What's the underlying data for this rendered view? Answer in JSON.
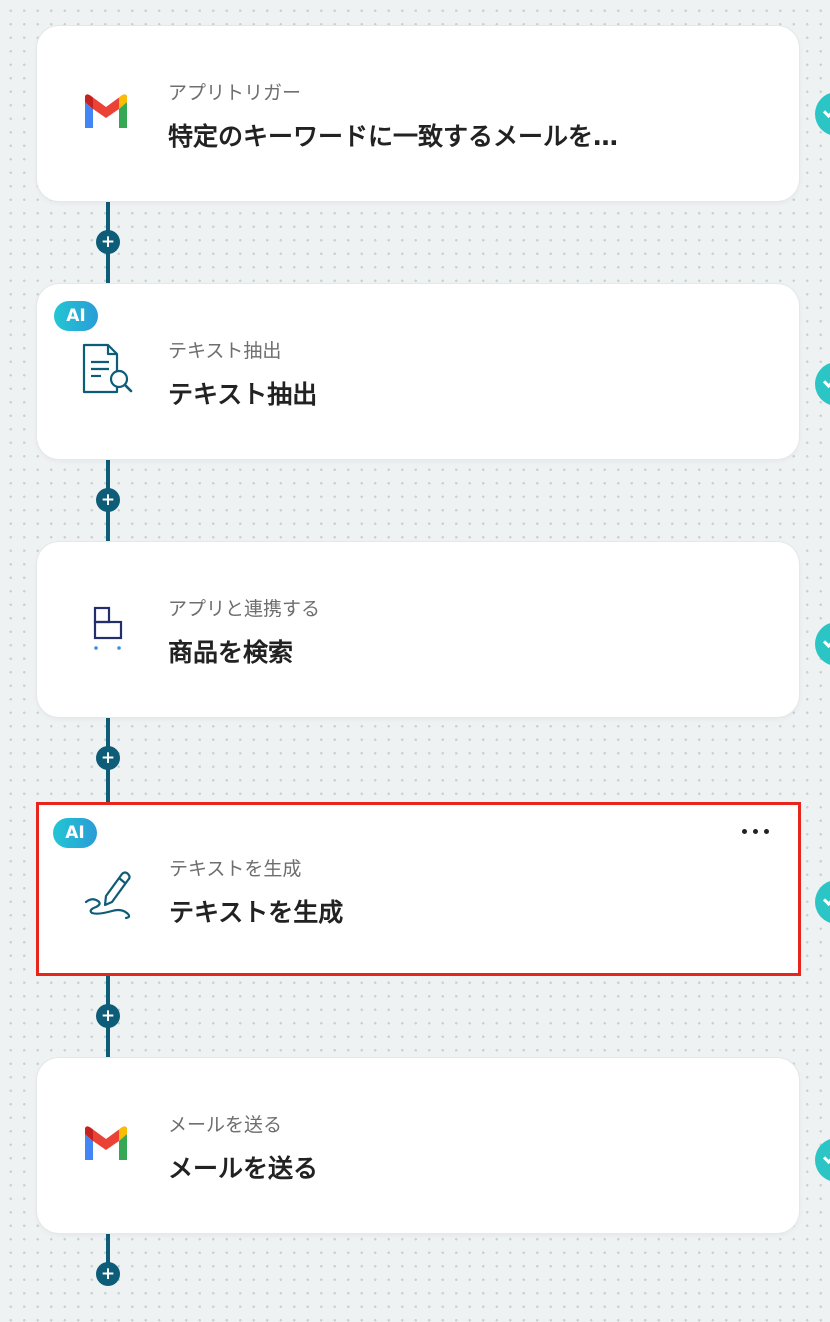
{
  "flow": {
    "steps": [
      {
        "subtitle": "アプリトリガー",
        "title": "特定のキーワードに一致するメールを…",
        "icon": "gmail-icon",
        "ai": false
      },
      {
        "subtitle": "テキスト抽出",
        "title": "テキスト抽出",
        "icon": "document-search-icon",
        "ai": true,
        "badge": "AI"
      },
      {
        "subtitle": "アプリと連携する",
        "title": "商品を検索",
        "icon": "shop-app-icon",
        "ai": false
      },
      {
        "subtitle": "テキストを生成",
        "title": "テキストを生成",
        "icon": "pen-write-icon",
        "ai": true,
        "badge": "AI",
        "selected": true
      },
      {
        "subtitle": "メールを送る",
        "title": "メールを送る",
        "icon": "gmail-icon",
        "ai": false
      }
    ],
    "add_symbol": "+"
  },
  "colors": {
    "connector": "#0d5c78",
    "selection_border": "#e8251b",
    "ai_badge_start": "#22c6d4",
    "ai_badge_end": "#2a9cd6",
    "status_indicator": "#2cc5c5",
    "background": "#eef2f3"
  }
}
